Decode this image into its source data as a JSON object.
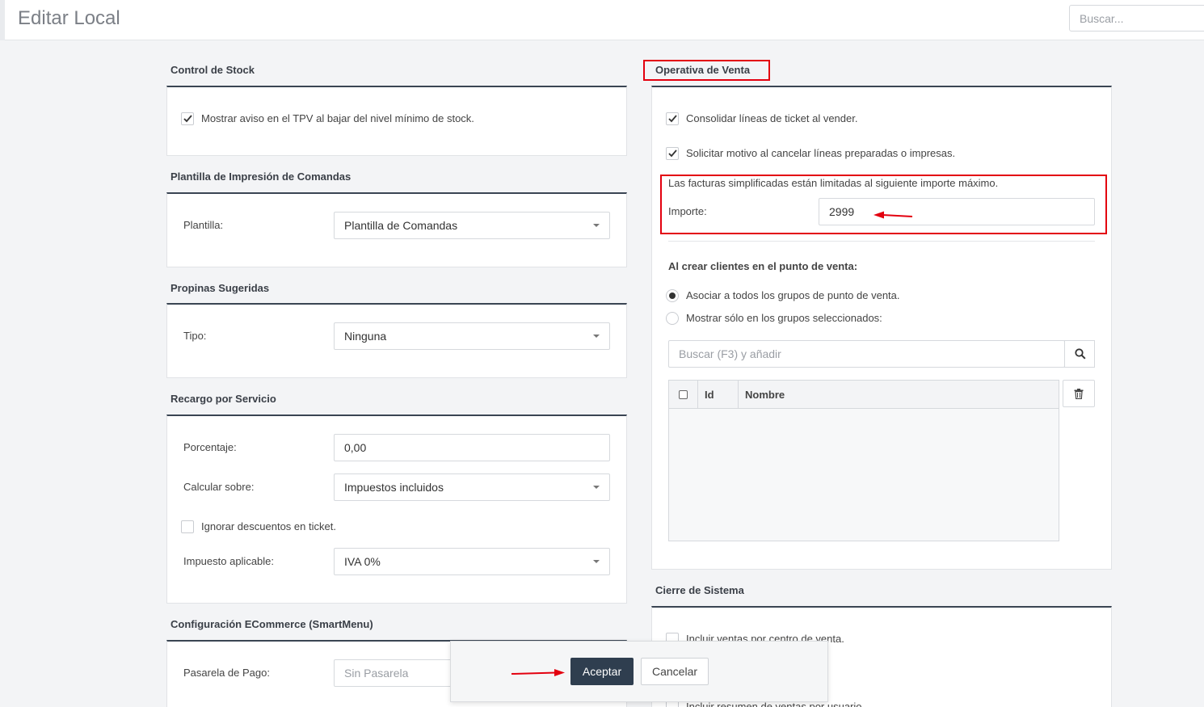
{
  "header": {
    "title": "Editar Local",
    "search_placeholder": "Buscar..."
  },
  "control_stock": {
    "title": "Control de Stock",
    "checkbox_label": "Mostrar aviso en el TPV al bajar del nivel mínimo de stock.",
    "checked": true
  },
  "plantilla": {
    "title": "Plantilla de Impresión de Comandas",
    "label": "Plantilla:",
    "value": "Plantilla de Comandas"
  },
  "propinas": {
    "title": "Propinas Sugeridas",
    "label": "Tipo:",
    "value": "Ninguna"
  },
  "recargo": {
    "title": "Recargo por Servicio",
    "porcentaje_label": "Porcentaje:",
    "porcentaje_value": "0,00",
    "calcular_label": "Calcular sobre:",
    "calcular_value": "Impuestos incluidos",
    "ignorar_label": "Ignorar descuentos en ticket.",
    "impuesto_label": "Impuesto aplicable:",
    "impuesto_value": "IVA 0%"
  },
  "ecommerce": {
    "title": "Configuración ECommerce (SmartMenu)",
    "pasarela_label": "Pasarela de Pago:",
    "pasarela_placeholder": "Sin Pasarela"
  },
  "operativa": {
    "title": "Operativa de Venta",
    "consolidar_label": "Consolidar líneas de ticket al vender.",
    "solicitar_label": "Solicitar motivo al cancelar líneas preparadas o impresas.",
    "facturas_text": "Las facturas simplificadas están limitadas al siguiente importe máximo.",
    "importe_label": "Importe:",
    "importe_value": "2999",
    "clientes_title": "Al crear clientes en el punto de venta:",
    "radio_all": "Asociar a todos los grupos de punto de venta.",
    "radio_selected": "Mostrar sólo en los grupos seleccionados:",
    "search_placeholder": "Buscar (F3) y añadir",
    "grid_columns": [
      "Id",
      "Nombre"
    ]
  },
  "cierre": {
    "title": "Cierre de Sistema",
    "incluir_ventas": "Incluir ventas por centro de venta.",
    "incluir_resumen": "Incluir resumen de ventas por usuario"
  },
  "dialog": {
    "accept": "Aceptar",
    "cancel": "Cancelar"
  },
  "colors": {
    "primary_button": "#2f3e4f",
    "annotation_red": "#e3000f",
    "panel_top_border": "#3a4553"
  }
}
